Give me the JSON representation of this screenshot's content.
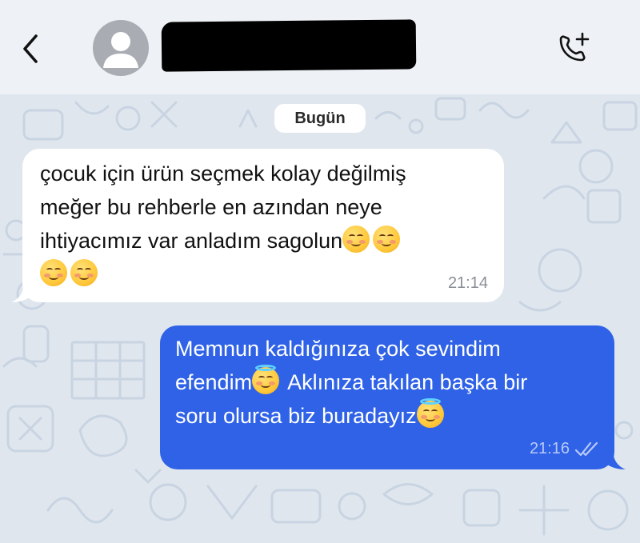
{
  "header": {
    "contact_name": "[redacted]",
    "icons": {
      "back": "chevron-left-icon",
      "avatar": "person-icon",
      "call": "add-call-icon"
    },
    "accent": "#007aff"
  },
  "chat": {
    "date_label": "Bugün",
    "wallpaper_color": "#dfe6ee",
    "messages": [
      {
        "direction": "incoming",
        "lines": [
          "çocuk için ürün seçmek kolay değilmiş",
          "meğer bu rehberle en azından neye",
          "ihtiyacımız var anladım sagolun"
        ],
        "emoji": "smiling-face-icon",
        "time": "21:14",
        "bubble_color": "#ffffff"
      },
      {
        "direction": "outgoing",
        "line1": "Memnun kaldığınıza çok sevindim",
        "line2a": "efendim",
        "line2b": "Aklınıza takılan başka bir",
        "line3": "soru olursa biz buradayız",
        "emoji": "smiling-face-with-halo-icon",
        "time": "21:16",
        "status": "read-double-check",
        "bubble_color": "#2f62e6"
      }
    ]
  }
}
